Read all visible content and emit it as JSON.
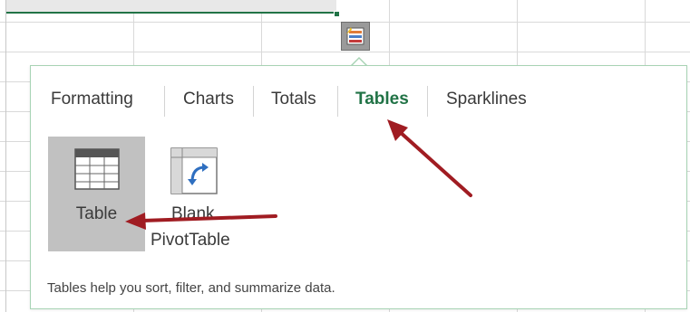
{
  "tabs": [
    {
      "label": "Formatting"
    },
    {
      "label": "Charts"
    },
    {
      "label": "Totals"
    },
    {
      "label": "Tables",
      "active": true
    },
    {
      "label": "Sparklines"
    }
  ],
  "options": [
    {
      "label": "Table",
      "icon": "table-icon",
      "selected": true
    },
    {
      "label_line1": "Blank",
      "label_line2": "PivotTable",
      "icon": "pivot-table-icon"
    }
  ],
  "description": "Tables help you sort, filter, and summarize data.",
  "quick_analysis_icon": "quick-analysis-icon",
  "colors": {
    "accent": "#217346",
    "panel_border": "#a7d3b4",
    "selected_bg": "#c1c1c1",
    "arrow": "#a01c22"
  }
}
